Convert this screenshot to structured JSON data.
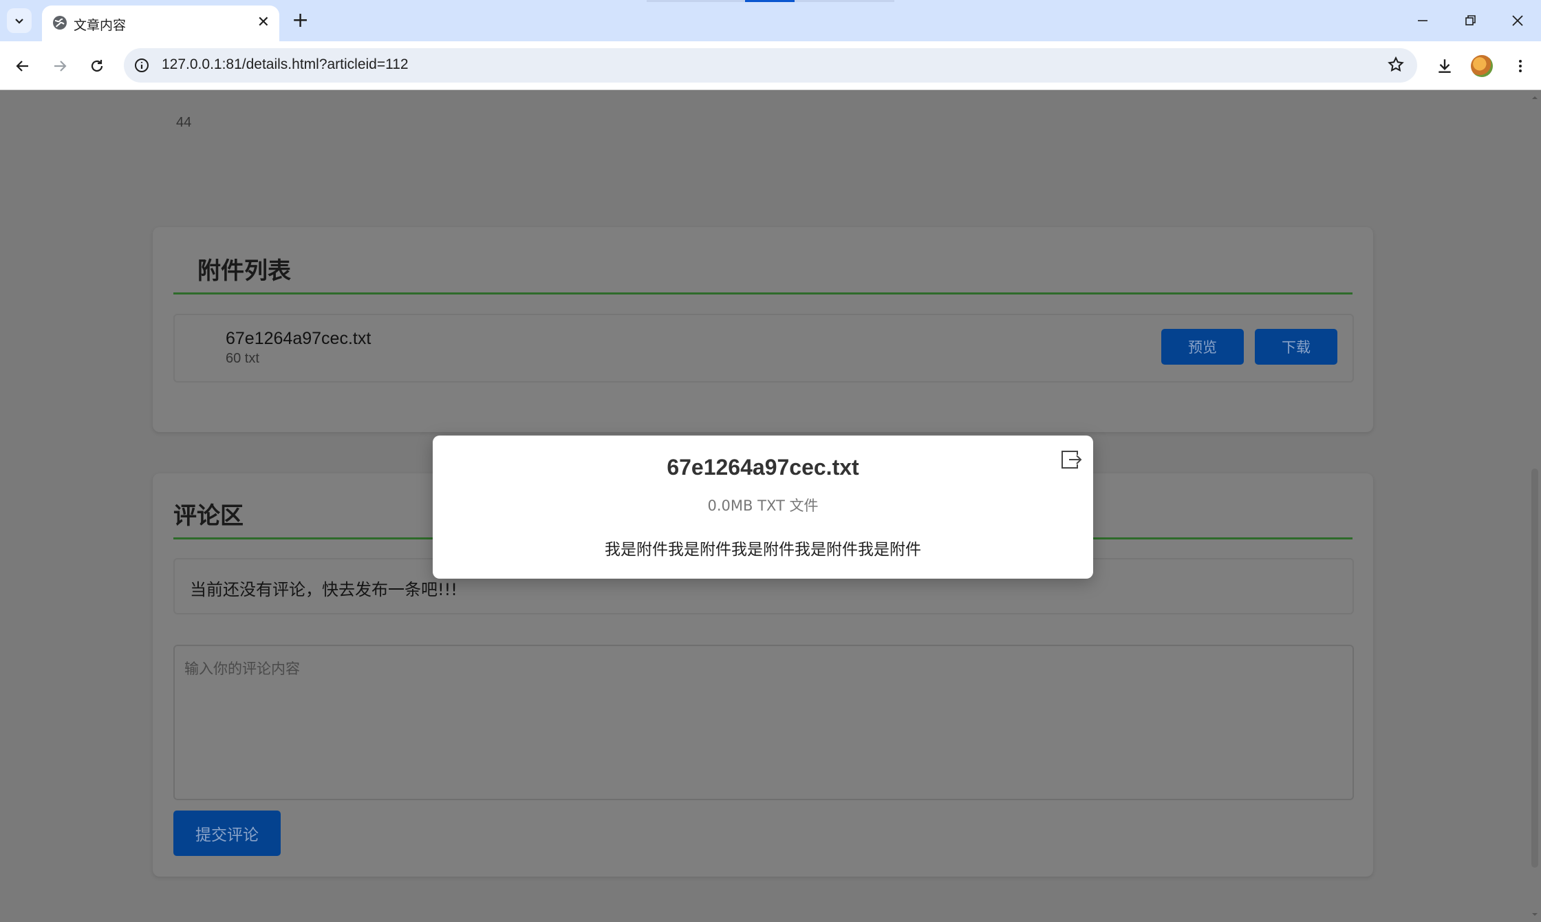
{
  "browser": {
    "tab_title": "文章内容",
    "url": "127.0.0.1:81/details.html?articleid=112",
    "icons": [
      "tab-search-icon",
      "globe-icon",
      "close-icon",
      "new-tab-icon",
      "minimize-icon",
      "restore-icon",
      "close-window-icon",
      "back-icon",
      "forward-icon",
      "reload-icon",
      "site-info-icon",
      "star-icon",
      "download-icon",
      "profile-avatar",
      "menu-icon"
    ]
  },
  "page": {
    "number_text": "44",
    "attachments": {
      "title": "附件列表",
      "file": {
        "name": "67e1264a97cec.txt",
        "meta": "60 txt"
      },
      "preview_label": "预览",
      "download_label": "下载"
    },
    "comments": {
      "title": "评论区",
      "empty_text": "当前还没有评论，快去发布一条吧!!!",
      "input_placeholder": "输入你的评论内容",
      "submit_label": "提交评论"
    }
  },
  "modal": {
    "title": "67e1264a97cec.txt",
    "meta": "0.0MB TXT 文件",
    "body": "我是附件我是附件我是附件我是附件我是附件"
  },
  "colors": {
    "tabbar_bg": "#d3e3fd",
    "primary_button": "#04428f",
    "heading_rule": "#2e6b2a",
    "overlay": "#7a7a7a"
  }
}
